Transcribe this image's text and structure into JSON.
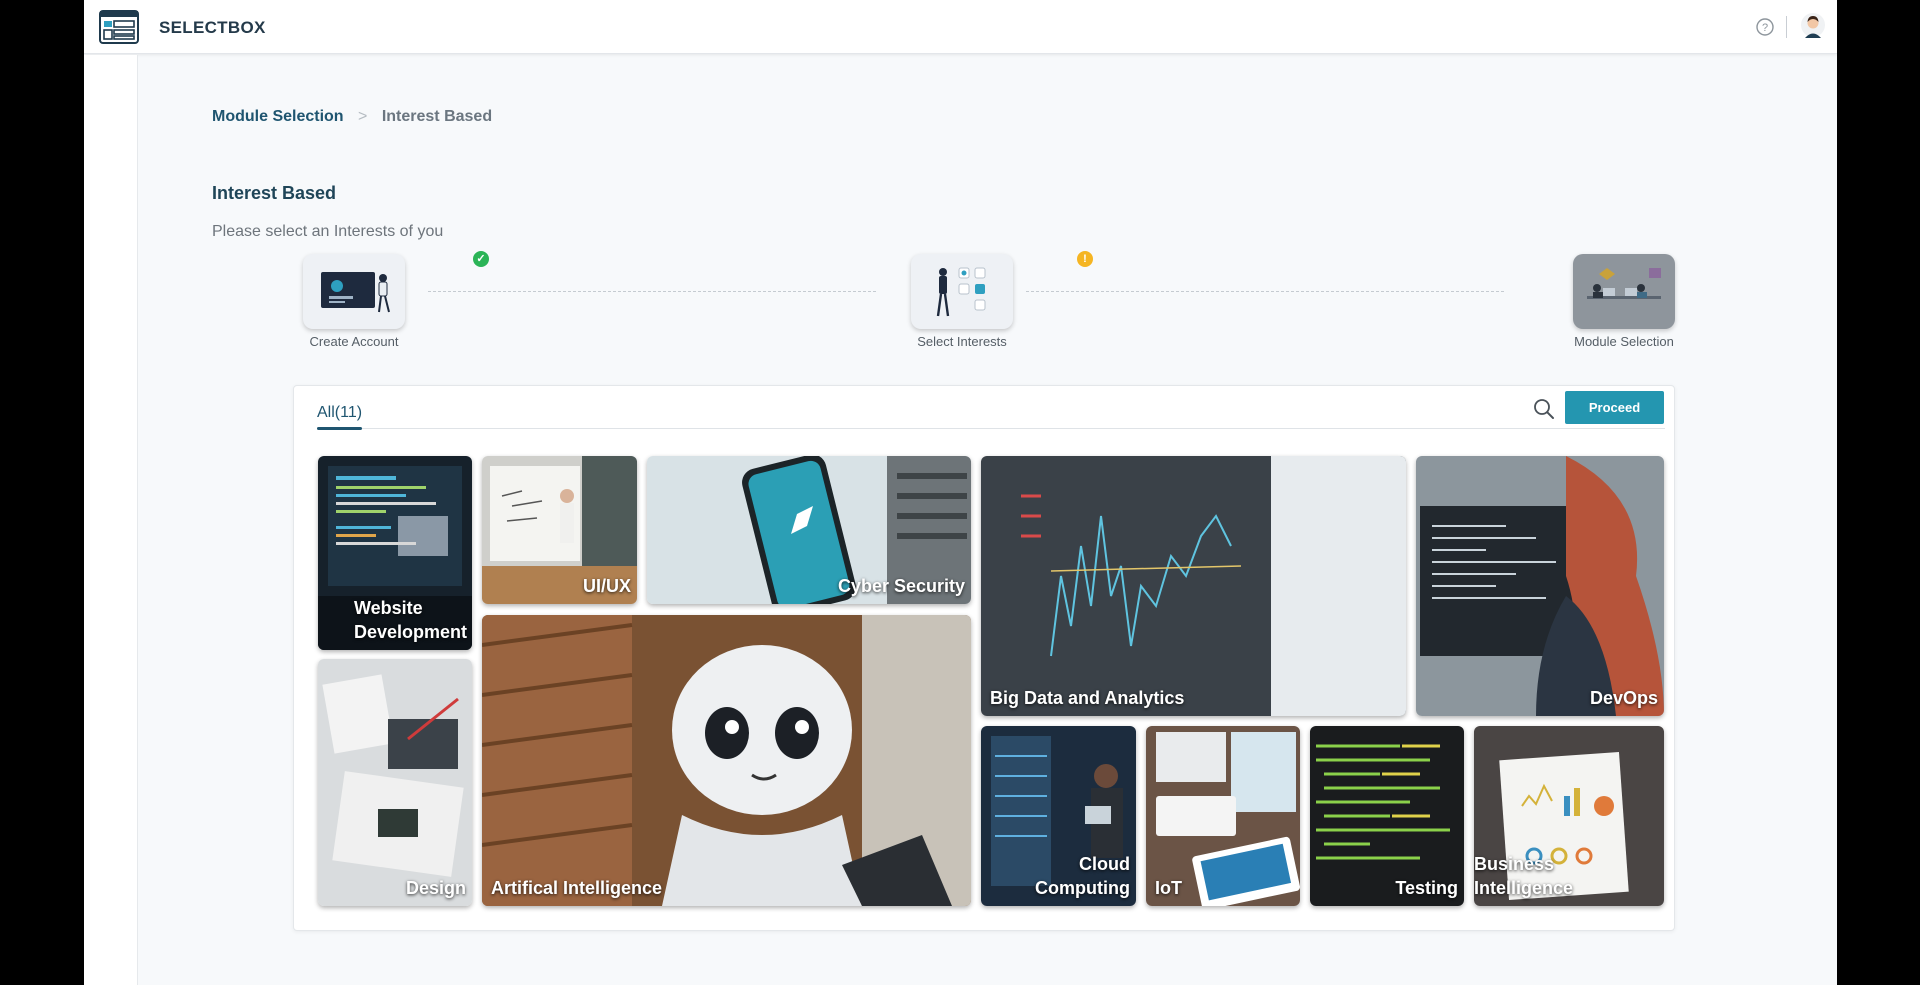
{
  "app": {
    "brand": "SELECTBOX"
  },
  "breadcrumb": {
    "root": "Module Selection",
    "separator": ">",
    "current": "Interest Based"
  },
  "page": {
    "title": "Interest Based",
    "subtitle": "Please select an Interests of you"
  },
  "steps": [
    {
      "label": "Create Account",
      "status": "done",
      "badge": "✓"
    },
    {
      "label": "Select Interests",
      "status": "pending",
      "badge": "!"
    },
    {
      "label": "Module Selection",
      "status": "inactive"
    }
  ],
  "tabs": {
    "all_label": "All(11)"
  },
  "actions": {
    "proceed_label": "Proceed"
  },
  "interests": [
    {
      "label_line1": "Website",
      "label_line2": "Development"
    },
    {
      "label": "UI/UX"
    },
    {
      "label": "Cyber Security"
    },
    {
      "label": "Big Data and Analytics"
    },
    {
      "label": "DevOps"
    },
    {
      "label": "Design"
    },
    {
      "label": "Artifical Intelligence"
    },
    {
      "label_line1": "Cloud",
      "label_line2": "Computing"
    },
    {
      "label": "IoT"
    },
    {
      "label": "Testing"
    },
    {
      "label": "Business Intelligence"
    }
  ],
  "icons": [
    "app-logo-icon",
    "help-icon",
    "user-avatar-icon",
    "search-icon",
    "check-icon",
    "warning-icon"
  ],
  "colors": {
    "primary": "#1f5570",
    "button": "#2496b0",
    "success": "#2bb457",
    "warning": "#f5b523"
  }
}
